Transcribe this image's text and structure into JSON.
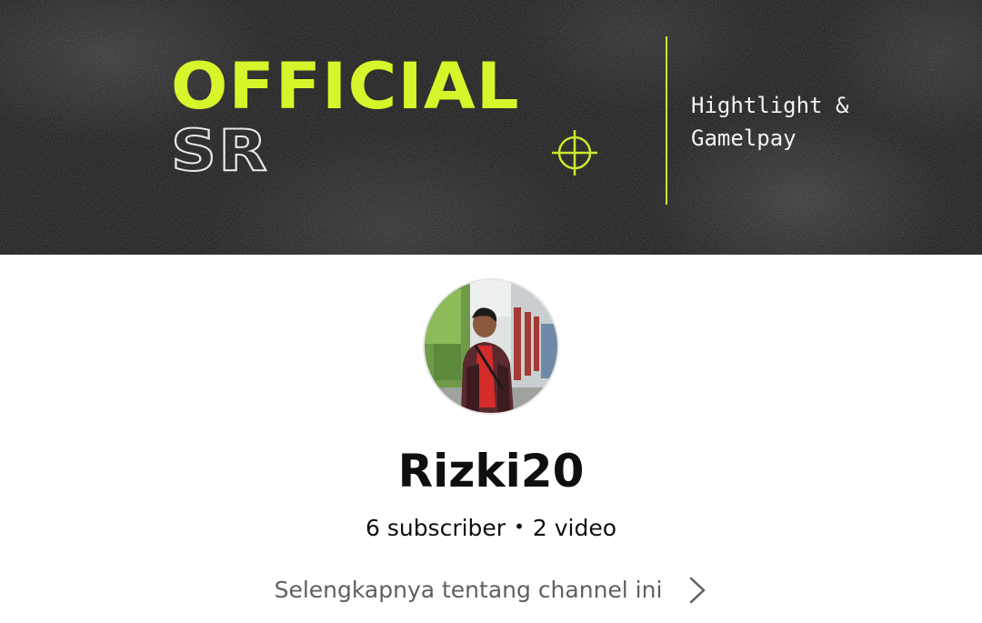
{
  "banner": {
    "title_line1": "OFFICIAL",
    "title_line2": "SR",
    "tagline": "Hightlight &\nGamelpay",
    "accent_color": "#d7f52a",
    "icons": {
      "crosshair": "crosshair-icon"
    }
  },
  "channel": {
    "avatar_icon": "avatar",
    "name": "Rizki20",
    "subscribers": "6 subscriber",
    "separator": "•",
    "videos": "2 video",
    "about_link": "Selengkapnya tentang channel ini",
    "about_icon": "chevron-right-icon"
  }
}
